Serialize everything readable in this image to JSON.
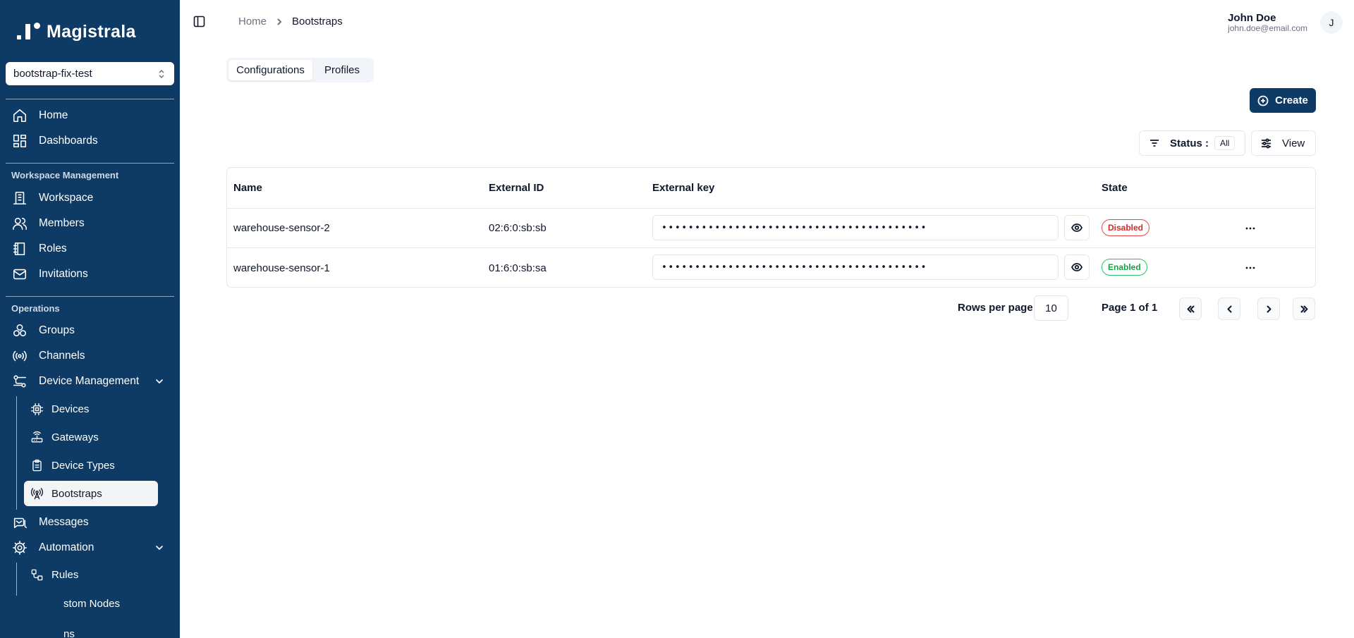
{
  "brand": {
    "name": "Magistrala"
  },
  "workspace_select": {
    "value": "bootstrap-fix-test"
  },
  "sidebar": {
    "top_items": [
      {
        "label": "Home",
        "icon": "home-icon"
      },
      {
        "label": "Dashboards",
        "icon": "dashboard-icon"
      }
    ],
    "sections": {
      "workspace_management": "Workspace Management",
      "operations": "Operations"
    },
    "workspace_items": [
      {
        "label": "Workspace",
        "icon": "building-icon"
      },
      {
        "label": "Members",
        "icon": "users-icon"
      },
      {
        "label": "Roles",
        "icon": "book-icon"
      },
      {
        "label": "Invitations",
        "icon": "mail-icon"
      }
    ],
    "operations_items": [
      {
        "label": "Groups",
        "icon": "groups-icon"
      },
      {
        "label": "Channels",
        "icon": "broadcast-icon"
      },
      {
        "label": "Device Management",
        "icon": "sliders-icon"
      }
    ],
    "device_sub_items": [
      {
        "label": "Devices",
        "icon": "cpu-icon"
      },
      {
        "label": "Gateways",
        "icon": "router-icon"
      },
      {
        "label": "Device Types",
        "icon": "clipboard-icon"
      },
      {
        "label": "Bootstraps",
        "icon": "antenna-icon"
      }
    ],
    "more_items": [
      {
        "label": "Messages",
        "icon": "messages-icon"
      },
      {
        "label": "Automation",
        "icon": "gear-icon"
      }
    ],
    "automation_sub_items": [
      {
        "label": "Rules",
        "icon": "workflow-icon"
      },
      {
        "label": "stom Nodes"
      },
      {
        "label": "ns"
      }
    ]
  },
  "header": {
    "breadcrumb": {
      "home": "Home",
      "current": "Bootstraps"
    },
    "user": {
      "name": "John Doe",
      "email": "john.doe@email.com",
      "initial": "J"
    }
  },
  "tabs": [
    {
      "label": "Configurations",
      "active": true
    },
    {
      "label": "Profiles",
      "active": false
    }
  ],
  "toolbar": {
    "create_label": "Create",
    "status_label": "Status :",
    "status_value": "All",
    "view_label": "View"
  },
  "table": {
    "columns": [
      "Name",
      "External ID",
      "External key",
      "State"
    ],
    "rows": [
      {
        "name": "warehouse-sensor-2",
        "external_id": "02:6:0:sb:sb",
        "external_key": "••••••••••••••••••••••••••••••••••••••••",
        "state": "Disabled"
      },
      {
        "name": "warehouse-sensor-1",
        "external_id": "01:6:0:sb:sa",
        "external_key": "••••••••••••••••••••••••••••••••••••••••",
        "state": "Enabled"
      }
    ]
  },
  "pagination": {
    "rows_per_page_label": "Rows per page",
    "rows_per_page": "10",
    "page_info": "Page 1 of 1"
  },
  "colors": {
    "sidebar_bg": "#0d3b66",
    "primary": "#0d3b66",
    "disabled": "#dc2626",
    "enabled": "#16a34a"
  }
}
